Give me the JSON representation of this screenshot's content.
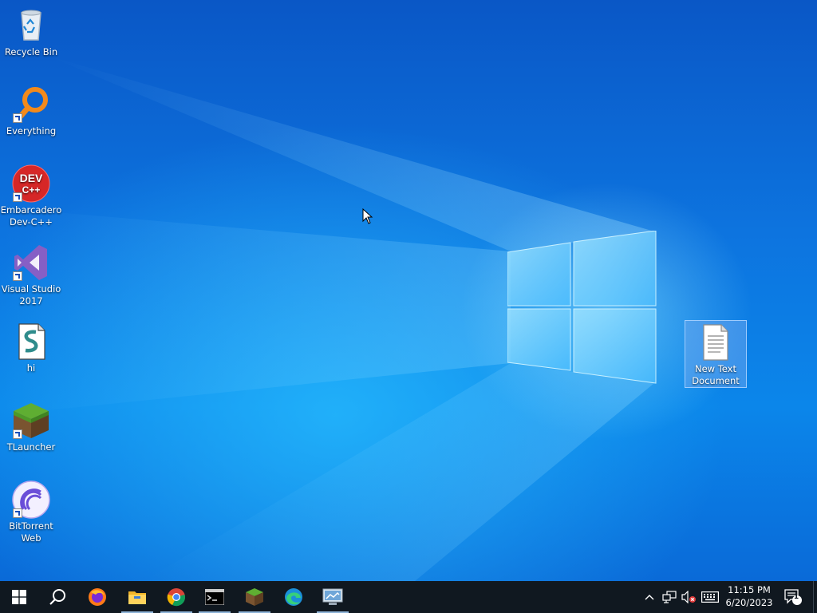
{
  "desktop": {
    "icons": [
      {
        "name": "Recycle Bin"
      },
      {
        "name": "Everything"
      },
      {
        "name": "Embarcadero Dev-C++"
      },
      {
        "name": "Visual Studio 2017"
      },
      {
        "name": "hi"
      },
      {
        "name": "TLauncher"
      },
      {
        "name": "BitTorrent Web"
      },
      {
        "name": "New Text Document"
      }
    ],
    "devcpp_badge_top": "DEV",
    "devcpp_badge_bottom": "C++"
  },
  "taskbar": {
    "buttons": [
      {
        "icon": "windows-start-icon"
      },
      {
        "icon": "search-icon"
      },
      {
        "icon": "firefox-icon"
      },
      {
        "icon": "file-explorer-icon"
      },
      {
        "icon": "chrome-icon"
      },
      {
        "icon": "terminal-icon"
      },
      {
        "icon": "minecraft-icon"
      },
      {
        "icon": "edge-icon"
      },
      {
        "icon": "remote-desktop-icon"
      }
    ],
    "clock": {
      "time": "11:15 PM",
      "date": "6/20/2023"
    },
    "notification_count": "1"
  },
  "colors": {
    "taskbar": "#101820",
    "desktop_accent": "#0b63d0"
  }
}
